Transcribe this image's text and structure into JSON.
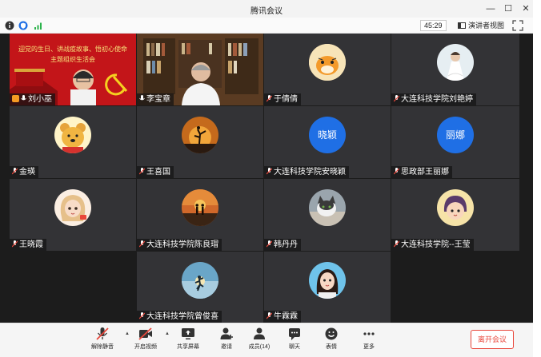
{
  "window": {
    "title": "腾讯会议"
  },
  "infobar": {
    "timer": "45:29",
    "speaker_view_label": "演讲者视图"
  },
  "participants": [
    {
      "name": "刘小巫",
      "banner_line1": "迎党的生日、讲战疫故事、悟初心使命",
      "banner_line2": "主题组织生活会"
    },
    {
      "name": "李宝章"
    },
    {
      "name": "于倩倩"
    },
    {
      "name": "大连科技学院刘艳婷"
    },
    {
      "name": "金瑛"
    },
    {
      "name": "王喜国"
    },
    {
      "name": "大连科技学院安晓颖",
      "avatar_text": "晓颖"
    },
    {
      "name": "思政部王丽娜",
      "avatar_text": "丽娜"
    },
    {
      "name": "王晓霞"
    },
    {
      "name": "大连科技学院陈良瑁"
    },
    {
      "name": "韩丹丹"
    },
    {
      "name": "大连科技学院--王莹"
    },
    {
      "name": "大连科技学院曾俊喜"
    },
    {
      "name": "牛霖霖"
    }
  ],
  "toolbar": {
    "mute_label": "解除静音",
    "video_label": "开启视频",
    "share_label": "共享屏幕",
    "invite_label": "邀请",
    "members_label": "成员(14)",
    "chat_label": "聊天",
    "emoji_label": "表情",
    "more_label": "更多",
    "leave_label": "离开会议"
  },
  "colors": {
    "accent_blue": "#1f6fe5",
    "leave_red": "#e9473b",
    "tile_bg": "#333336"
  }
}
